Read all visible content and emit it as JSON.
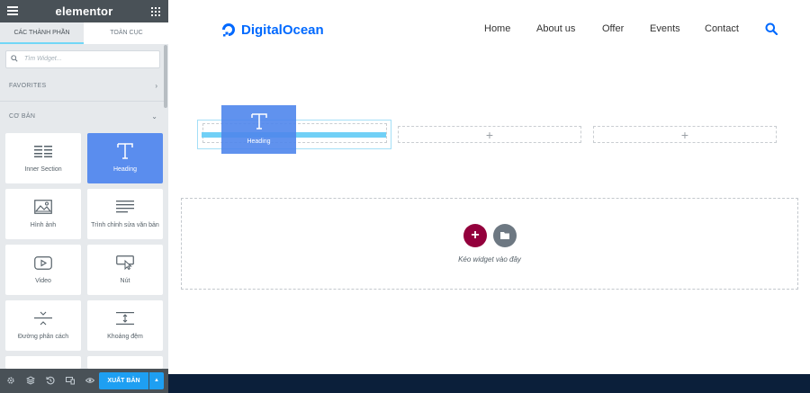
{
  "panel": {
    "app_name": "elementor",
    "tabs": [
      {
        "label": "CÁC THÀNH PHẦN",
        "active": true
      },
      {
        "label": "TOÀN CỤC",
        "active": false
      }
    ],
    "search_placeholder": "Tìm Widget...",
    "categories": {
      "favorites": "FAVORITES",
      "basic": "CƠ BẢN"
    },
    "widgets": [
      {
        "label": "Inner Section",
        "icon": "inner-section-icon"
      },
      {
        "label": "Heading",
        "icon": "heading-icon",
        "selected": true
      },
      {
        "label": "Hình ảnh",
        "icon": "image-icon"
      },
      {
        "label": "Trình chỉnh sửa văn bản",
        "icon": "text-editor-icon"
      },
      {
        "label": "Video",
        "icon": "video-icon"
      },
      {
        "label": "Nút",
        "icon": "button-icon"
      },
      {
        "label": "Đường phân cách",
        "icon": "divider-icon"
      },
      {
        "label": "Khoảng đệm",
        "icon": "spacer-icon"
      }
    ],
    "footer": {
      "publish_label": "XUẤT BẢN",
      "icons": [
        "settings-icon",
        "navigator-icon",
        "history-icon",
        "responsive-icon",
        "preview-icon",
        "chevron-up-icon"
      ]
    }
  },
  "site": {
    "brand": "DigitalOcean",
    "nav": [
      "Home",
      "About us",
      "Offer",
      "Events",
      "Contact"
    ]
  },
  "canvas": {
    "drag_widget_label": "Heading",
    "drop_zone_text": "Kéo widget vào đây",
    "plus_sign": "+",
    "add_button_symbol": "+"
  },
  "colors": {
    "panel_header": "#495157",
    "accent_selected": "#5a8dee",
    "brand_blue": "#0069ff",
    "add_section": "#93003c",
    "publish": "#1e9ff2"
  }
}
